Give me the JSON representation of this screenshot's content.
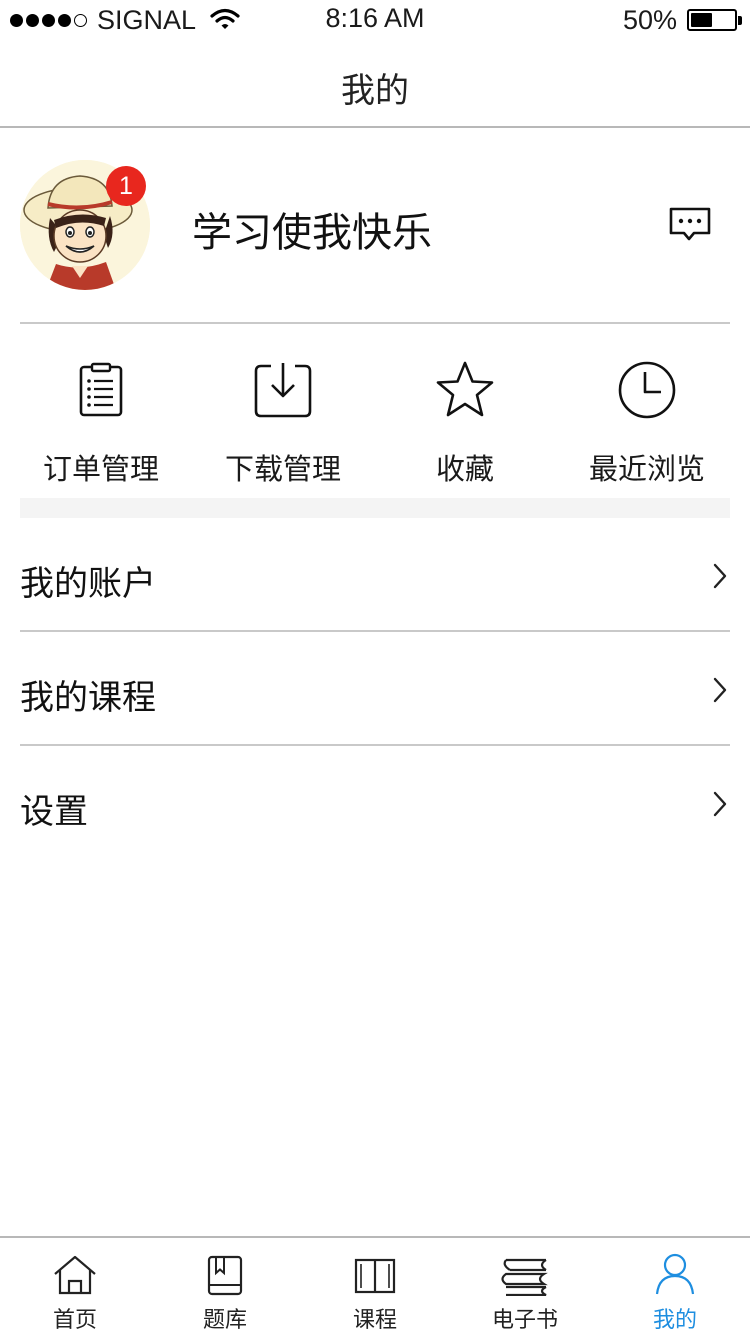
{
  "status_bar": {
    "carrier": "SIGNAL",
    "time": "8:16 AM",
    "battery_percent": "50%",
    "battery_level": 0.5,
    "signal_bars_filled": 4,
    "signal_bars_total": 5
  },
  "nav": {
    "title": "我的"
  },
  "profile": {
    "username": "学习使我快乐",
    "badge_count": "1",
    "avatar_icon": "avatar-straw-hat",
    "message_icon": "message-bubble-icon"
  },
  "quick_actions": [
    {
      "label": "订单管理",
      "icon": "clipboard-list-icon"
    },
    {
      "label": "下载管理",
      "icon": "download-tray-icon"
    },
    {
      "label": "收藏",
      "icon": "star-icon"
    },
    {
      "label": "最近浏览",
      "icon": "clock-icon"
    }
  ],
  "menu": [
    {
      "label": "我的账户"
    },
    {
      "label": "我的课程"
    },
    {
      "label": "设置"
    }
  ],
  "tabs": [
    {
      "label": "首页",
      "icon": "home-icon",
      "active": false
    },
    {
      "label": "题库",
      "icon": "question-bank-icon",
      "active": false
    },
    {
      "label": "课程",
      "icon": "open-book-icon",
      "active": false
    },
    {
      "label": "电子书",
      "icon": "ebook-stack-icon",
      "active": false
    },
    {
      "label": "我的",
      "icon": "person-icon",
      "active": true
    }
  ],
  "colors": {
    "accent": "#1e8ee0",
    "badge": "#e8271e",
    "divider": "#c9c9c9"
  }
}
